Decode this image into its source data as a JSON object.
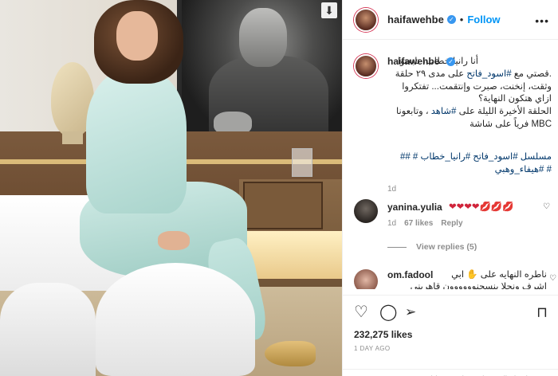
{
  "header": {
    "username": "haifawehbe",
    "verified_glyph": "✓",
    "separator": "•",
    "follow_label": "Follow",
    "more_icon": "more-icon"
  },
  "caption": {
    "username": "haifawehbe",
    "line1": "أنا رانيا خطاب، تابعتوا",
    "line2": ".قصتي مع ",
    "tag_show": "#اسود_فاتح",
    "line2b": " على مدى ٢٩ حلقة",
    "line3": "وثقت، إنخنت، صبرت وإنتقمت... تفتكروا",
    "line4": "ازاي هتكون النهاية؟",
    "line5": "الحلقة الأخيرة الليلة على ",
    "tag_shahid": "#شاهد",
    "line5b": " ، وتابعونا",
    "line6": "MBC فرياً على شاشة",
    "tags_line1": "مسلسل #اسود_فاتح #رانيا_خطاب # ##",
    "tags_line2": "# #هيفاء_وهبي",
    "time": "1d"
  },
  "comments": [
    {
      "username": "yanina.yulia",
      "text": "❤❤❤❤💋💋💋",
      "time": "1d",
      "likes": "67 likes",
      "reply_label": "Reply",
      "view_replies": "View replies (5)"
    },
    {
      "username": "om.fadool",
      "text": "ناطره النهايه على ✋ ابي اشرف ونحلا بنسجنوووووون قاهريني"
    }
  ],
  "actions": {
    "like_icon": "heart-icon",
    "comment_icon": "comment-icon",
    "share_icon": "share-icon",
    "save_icon": "bookmark-icon",
    "likes": "232,275 likes",
    "date": "1 DAY AGO"
  },
  "footer": {
    "limited_text": "Comments on this post have been limited"
  },
  "photo": {
    "save_badge_icon": "download-icon"
  }
}
